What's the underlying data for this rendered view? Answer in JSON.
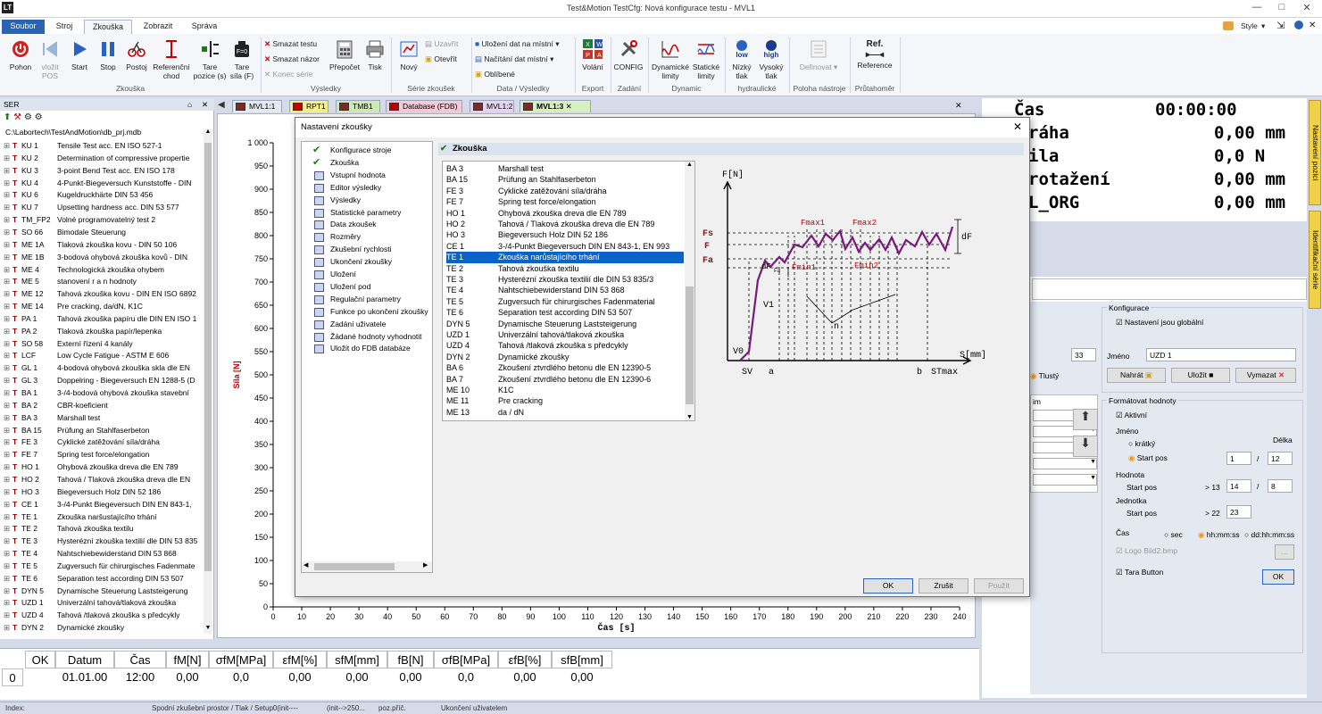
{
  "window": {
    "title": "Test&Motion  TestCfg: Nová konfigurace testu - MVL1",
    "style_label": "Style"
  },
  "ribbon_tabs": [
    "Soubor",
    "Stroj",
    "Zkouška",
    "Zobrazit",
    "Správa"
  ],
  "ribbon": {
    "buttons": [
      {
        "label": "Pohon",
        "icon": "power-icon"
      },
      {
        "label": "vložit\nPOS",
        "icon": "insert-pos-icon",
        "disabled": true
      },
      {
        "label": "Start",
        "icon": "play-icon"
      },
      {
        "label": "Stop",
        "icon": "pause-icon"
      },
      {
        "label": "Postoj",
        "icon": "posture-icon"
      },
      {
        "label": "Referenční\nchod",
        "icon": "reference-run-icon"
      },
      {
        "label": "Tare\npozice (s)",
        "icon": "tare-position-icon"
      },
      {
        "label": "Tare\nsíla (F)",
        "icon": "tare-force-icon"
      }
    ],
    "small_buttons": [
      "Smazat testu",
      "Smazat názor",
      "Konec série"
    ],
    "buttons2": [
      {
        "label": "Přepočet"
      },
      {
        "label": "Tisk"
      },
      {
        "label": "Nový"
      }
    ],
    "series_small": [
      "Uzavřít",
      "Otevřít"
    ],
    "data_small": [
      "Uložení dat na místní",
      "Načítání dat místní",
      "Oblíbené"
    ],
    "buttons3": [
      {
        "label": "Volání"
      },
      {
        "label": "CONFIG"
      },
      {
        "label": "Dynamické\nlimity"
      },
      {
        "label": "Statické\nlimity"
      },
      {
        "label": "Nízký\ntlak"
      },
      {
        "label": "Vysoký\ntlak"
      },
      {
        "label": "Definovat"
      },
      {
        "label": "Reference"
      }
    ],
    "hydraulic_icons": [
      "low",
      "high"
    ],
    "ref_icon": "Ref.",
    "groups": [
      "Zkouška",
      "Výsledky",
      "Série zkoušek",
      "Data / Výsledky",
      "Export",
      "Zadání",
      "Dynamic",
      "hydraulické",
      "Poloha nástroje",
      "Průtahoměr"
    ]
  },
  "left_panel": {
    "header": "SER",
    "path": "C:\\Labortech\\TestAndMotion\\db_prj.mdb",
    "items": [
      [
        "KU 1",
        "Tensile Test acc. EN ISO 527-1"
      ],
      [
        "KU 2",
        "Determination of compressive propertie"
      ],
      [
        "KU 3",
        "3-point Bend Test acc. EN ISO 178"
      ],
      [
        "KU 4",
        "4-Punkt-Biegeversuch Kunststoffe - DIN"
      ],
      [
        "KU 6",
        "Kugeldruckhärte DIN 53 456"
      ],
      [
        "KU 7",
        "Upsetting hardness acc. DIN 53 577"
      ],
      [
        "TM_FP2",
        "Volné programovatelný test 2"
      ],
      [
        "SO 66",
        "Bimodale Steuerung"
      ],
      [
        "ME 1A",
        "Tlaková zkouška kovu - DIN 50 106"
      ],
      [
        "ME 1B",
        "3-bodová ohybová zkouška kovů - DIN"
      ],
      [
        "ME 4",
        "Technologická zkouška ohybem"
      ],
      [
        "ME 5",
        "stanovení r a n hodnoty"
      ],
      [
        "ME 12",
        "Tahová zkouška kovu - DIN EN ISO 6892"
      ],
      [
        "ME 14",
        "Pre cracking, da/dN, K1C"
      ],
      [
        "PA 1",
        "Tahová zkouška papíru dle DIN EN ISO 1"
      ],
      [
        "PA 2",
        "Tlaková zkouška papír/lepenka"
      ],
      [
        "SO 58",
        "Externí řízení 4 kanály"
      ],
      [
        "LCF",
        "Low Cycle Fatigue - ASTM E 606"
      ],
      [
        "GL 1",
        "4-bodová ohybová zkouška skla dle  EN"
      ],
      [
        "GL 3",
        "Doppelring - Biegeversuch EN 1288-5 (D"
      ],
      [
        "BA 1",
        "3-/4-bodová ohybová zkouška stavební"
      ],
      [
        "BA 2",
        "CBR-koeficient"
      ],
      [
        "BA 3",
        "Marshall test"
      ],
      [
        "BA 15",
        "Prüfung an Stahlfaserbeton"
      ],
      [
        "FE 3",
        "Cyklické zatěžování síla/dráha"
      ],
      [
        "FE 7",
        "Spring test force/elongation"
      ],
      [
        "HO 1",
        "Ohybová zkouška dreva dle EN 789"
      ],
      [
        "HO 2",
        "Tahová / Tlaková zkouška dreva dle EN"
      ],
      [
        "HO 3",
        "Biegeversuch Holz  DIN 52 186"
      ],
      [
        "CE 1",
        "3-/4-Punkt Biegeversuch DIN EN 843-1,"
      ],
      [
        "TE 1",
        "Zkouška naršustajícího trhání"
      ],
      [
        "TE 2",
        "Tahová zkouška textilu"
      ],
      [
        "TE 3",
        "Hysterézní zkouška textilií dle DIN 53 835"
      ],
      [
        "TE 4",
        "Nahtschiebewiderstand DIN 53 868"
      ],
      [
        "TE 5",
        "Zugversuch für chirurgisches Fadenmate"
      ],
      [
        "TE 6",
        "Separation test according DIN 53 507"
      ],
      [
        "DYN 5",
        "Dynamische Steuerung Laststeigerung"
      ],
      [
        "UZD 1",
        "Univerzální tahová/tlaková zkouška"
      ],
      [
        "UZD 4",
        "Tahová /tlaková zkouška s předcykly"
      ],
      [
        "DYN 2",
        "Dynamické zkoušky"
      ]
    ]
  },
  "doc_tabs": [
    "MVL1:1",
    "RPT1",
    "TMB1",
    "Database (FDB)",
    "MVL1:2",
    "MVL1:3"
  ],
  "chart_data": {
    "type": "line",
    "xlabel": "Čas [s]",
    "ylabel": "Síla [N]",
    "xlim": [
      0,
      240
    ],
    "ylim": [
      0,
      1000
    ],
    "x_ticks": [
      0,
      10,
      20,
      30,
      40,
      50,
      60,
      70,
      80,
      90,
      100,
      110,
      120,
      130,
      140,
      150,
      160,
      170,
      180,
      190,
      200,
      210,
      220,
      230,
      240
    ],
    "y_ticks": [
      0,
      50,
      100,
      150,
      200,
      250,
      300,
      350,
      400,
      450,
      500,
      550,
      600,
      650,
      700,
      750,
      800,
      850,
      900,
      950,
      1000
    ],
    "y_tick_labels": [
      "0",
      "50",
      "100",
      "150",
      "200",
      "250",
      "300",
      "350",
      "400",
      "450",
      "500",
      "550",
      "600",
      "650",
      "700",
      "750",
      "800",
      "850",
      "900",
      "950",
      "1 000"
    ],
    "series": [
      {
        "values": []
      }
    ]
  },
  "dialog": {
    "title": "Nastavení zkoušky",
    "nav": [
      {
        "label": "Konfigurace stroje",
        "checked": true
      },
      {
        "label": "Zkouška",
        "checked": true
      },
      {
        "label": "Vstupní hodnota"
      },
      {
        "label": "Editor výsledky"
      },
      {
        "label": "Výsledky"
      },
      {
        "label": "Statistické parametry"
      },
      {
        "label": "Data zkoušek"
      },
      {
        "label": "Rozměry"
      },
      {
        "label": "Zkušební rychlosti"
      },
      {
        "label": "Ukončení zkoušky"
      },
      {
        "label": "Uložení"
      },
      {
        "label": "Uložení pod"
      },
      {
        "label": "Regulační parametry"
      },
      {
        "label": "Funkce po ukončení zkoušky"
      },
      {
        "label": "Zadání uživatele"
      },
      {
        "label": "Žádané hodnoty vyhodnotit"
      },
      {
        "label": "Uložit do FDB databáze"
      }
    ],
    "section_title": "Zkouška",
    "tests": [
      [
        "BA 3",
        "Marshall test"
      ],
      [
        "BA 15",
        "Prüfung an Stahlfaserbeton"
      ],
      [
        "FE 3",
        "Cyklické zatěžování síla/dráha"
      ],
      [
        "FE 7",
        "Spring test force/elongation"
      ],
      [
        "HO 1",
        "Ohybová zkouška dreva dle EN 789"
      ],
      [
        "HO 2",
        "Tahová / Tlaková zkouška dreva dle EN 789"
      ],
      [
        "HO 3",
        "Biegeversuch Holz  DIN 52 186"
      ],
      [
        "CE 1",
        "3-/4-Punkt Biegeversuch DIN EN 843-1, EN 993"
      ],
      [
        "TE 1",
        "Zkouška narůstajícího trhání"
      ],
      [
        "TE 2",
        "Tahová zkouška textilu"
      ],
      [
        "TE 3",
        "Hysterézní zkouška textilií dle DIN 53 835/3"
      ],
      [
        "TE 4",
        "Nahtschiebewiderstand DIN 53 868"
      ],
      [
        "TE 5",
        "Zugversuch für chirurgisches Fadenmaterial"
      ],
      [
        "TE 6",
        "Separation test according DIN 53 507"
      ],
      [
        "DYN 5",
        "Dynamische Steuerung Laststeigerung"
      ],
      [
        "UZD 1",
        "Univerzální tahová/tlaková zkouška"
      ],
      [
        "UZD 4",
        "Tahová /tlaková zkouška s předcykly"
      ],
      [
        "DYN 2",
        "Dynamické zkoušky"
      ],
      [
        "BA 6",
        "Zkoušení ztvrdlého betonu dle EN 12390-5"
      ],
      [
        "BA 7",
        "Zkoušení ztvrdlého betonu dle EN 12390-6"
      ],
      [
        "ME 10",
        "K1C"
      ],
      [
        "ME 11",
        "Pre cracking"
      ],
      [
        "ME 13",
        "da / dN"
      ]
    ],
    "selected_index": 8,
    "diagram": {
      "F_axis": "F[N]",
      "S_axis": "S[mm]",
      "Fs": "Fs",
      "F": "F",
      "Fa": "Fa",
      "Fmax1": "Fmax1",
      "Fmax2": "Fmax2",
      "Fmin1": "Fmin1",
      "Fmin2": "Fmin2",
      "dF": "dF",
      "dFFa": "dF",
      "Fa_sub": "Fa",
      "V1": "V1",
      "V0": "V0",
      "n": "n",
      "SV": "SV",
      "a": "a",
      "b": "b",
      "STmax": "STmax"
    },
    "buttons": {
      "ok": "OK",
      "cancel": "Zrušit",
      "apply": "Použít"
    }
  },
  "right_panel": {
    "display": [
      {
        "label": "Čas",
        "value": "00:00:00"
      },
      {
        "label": "ráha",
        "value": "0,00 mm"
      },
      {
        "label": "ila",
        "value": "0,0 N"
      },
      {
        "label": "rotažení",
        "value": "0,00 mm"
      },
      {
        "label": "L_ORG",
        "value": "0,00 mm"
      }
    ],
    "vtabs": [
      "Nastavení pozici",
      "Identifikační série"
    ],
    "config": {
      "group_title": "Konfigurace",
      "global_label": "Nastavení jsou globální",
      "name_label": "Jméno",
      "name_value": "UZD 1",
      "left_value": "33",
      "bold_label": "Tlustý",
      "load_btn": "Nahrát",
      "save_btn": "Uložit",
      "delete_btn": "Vymazat",
      "format_group": "Formátovat hodnoty",
      "active_label": "Aktivní",
      "jmeno_label": "Jméno",
      "delka_label": "Délka",
      "short_label": "krátký",
      "startpos_label": "Start pos",
      "name_start": "1",
      "name_len": "12",
      "hodnota_label": "Hodnota",
      "hodnota_start_label": "Start pos",
      "gt13": "> 13",
      "val_start": "14",
      "val_len": "8",
      "unit_label": "Jednotka",
      "unit_start_label": "Start pos",
      "gt22": "> 22",
      "unit_start": "23",
      "cas_label": "Čas",
      "sec_label": "sec",
      "hhmmss_label": "hh:mm:ss",
      "ddhhmmss_label": "dd:hh:mm:ss",
      "logo_label": "Logo",
      "logo_file": "Bild2.bmp",
      "browse_btn": "...",
      "tara_label": "Tara Button",
      "ok_btn": "OK",
      "combo_header": "im"
    }
  },
  "results_table": {
    "headers": [
      "OK",
      "Datum",
      "Čas",
      "fM[N]",
      "σfM[MPa]",
      "εfM[%]",
      "sfM[mm]",
      "fB[N]",
      "σfB[MPa]",
      "εfB[%]",
      "sfB[mm]"
    ],
    "rows": [
      [
        "0",
        "01.01.00",
        "12:00",
        "0,00",
        "0,0",
        "0,00",
        "0,00",
        "0,00",
        "0,0",
        "0,00",
        "0,00"
      ]
    ]
  },
  "status_bar": [
    "Index:",
    "Spodní zkušební prostor / Tlak / Setup0(init----",
    "(init-->250...",
    "poz.příč.",
    "Ukončení uživatelem"
  ],
  "colors": {
    "accent": "#2b63b4",
    "selection": "#0a64c8",
    "diagram_curve": "#7a1a7a",
    "diagram_labels": "#c00000"
  }
}
